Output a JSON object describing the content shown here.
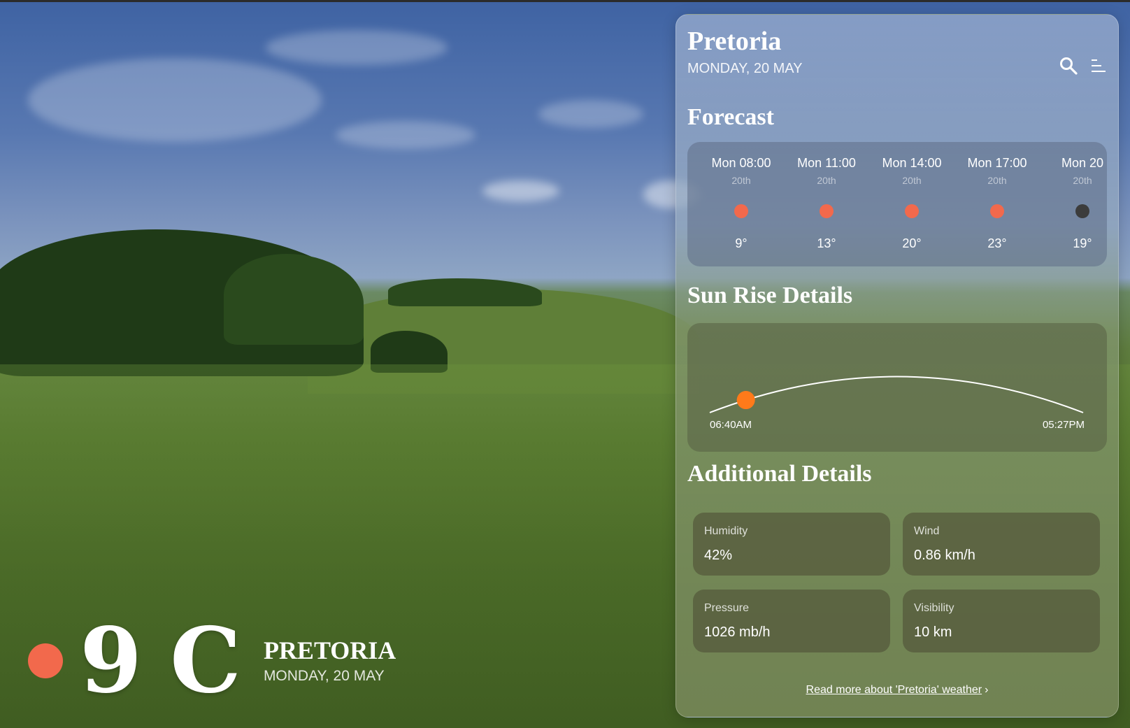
{
  "location": {
    "city": "PRETORIA",
    "date": "MONDAY, 20 MAY"
  },
  "current": {
    "temperature": "9",
    "unit": "C",
    "condition_icon": "sun-icon",
    "condition_color": "#f2694c"
  },
  "panel": {
    "city": "Pretoria",
    "date": "MONDAY, 20 MAY",
    "icons": [
      "search-icon",
      "menu-icon"
    ]
  },
  "forecast": {
    "title": "Forecast",
    "items": [
      {
        "time": "Mon 08:00",
        "day": "20th",
        "temp": "9°",
        "icon": "sun-icon",
        "color": "#f2694c"
      },
      {
        "time": "Mon 11:00",
        "day": "20th",
        "temp": "13°",
        "icon": "sun-icon",
        "color": "#f2694c"
      },
      {
        "time": "Mon 14:00",
        "day": "20th",
        "temp": "20°",
        "icon": "sun-icon",
        "color": "#f2694c"
      },
      {
        "time": "Mon 17:00",
        "day": "20th",
        "temp": "23°",
        "icon": "sun-icon",
        "color": "#f2694c"
      },
      {
        "time": "Mon 20",
        "day": "20th",
        "temp": "19°",
        "icon": "moon-icon",
        "color": "#3c3c3c"
      }
    ]
  },
  "sunrise": {
    "title": "Sun Rise Details",
    "sunrise": "06:40AM",
    "sunset": "05:27PM",
    "sun_color": "#ff7a1a",
    "day_progress": 0.1
  },
  "details": {
    "title": "Additional Details",
    "items": [
      {
        "label": "Humidity",
        "value": "42%"
      },
      {
        "label": "Wind",
        "value": "0.86 km/h"
      },
      {
        "label": "Pressure",
        "value": "1026 mb/h"
      },
      {
        "label": "Visibility",
        "value": "10 km"
      }
    ]
  },
  "footer": {
    "read_more": "Read more about 'Pretoria' weather"
  }
}
